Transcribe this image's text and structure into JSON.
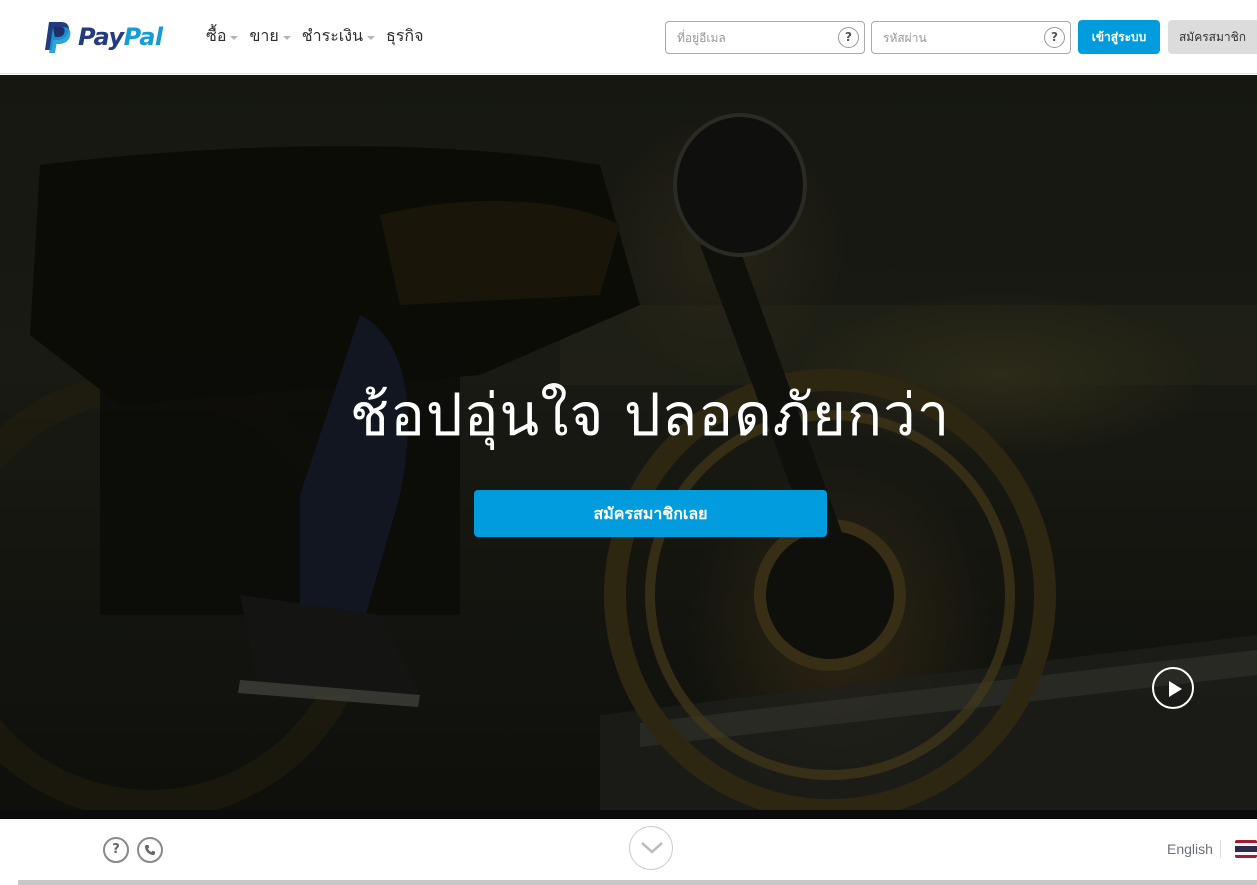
{
  "brand": {
    "pay": "Pay",
    "pal": "Pal",
    "colors": {
      "dark": "#253b80",
      "light": "#179bd7"
    }
  },
  "nav": {
    "items": [
      {
        "label": "ซื้อ",
        "has_dropdown": true
      },
      {
        "label": "ขาย",
        "has_dropdown": true
      },
      {
        "label": "ชำระเงิน",
        "has_dropdown": true
      },
      {
        "label": "ธุรกิจ",
        "has_dropdown": false
      }
    ]
  },
  "login": {
    "email_placeholder": "ที่อยู่อีเมล",
    "email_value": "",
    "password_placeholder": "รหัสผ่าน",
    "password_value": "",
    "help_symbol": "?",
    "login_button": "เข้าสู่ระบบ",
    "signup_button": "สมัครสมาชิก"
  },
  "hero": {
    "headline": "ช้อปอุ่นใจ ปลอดภัยกว่า",
    "cta": "สมัครสมาชิกเลย",
    "play_icon": "play-icon"
  },
  "footer": {
    "help_symbol": "?",
    "language_link": "English",
    "flag": "thailand-flag-icon"
  },
  "colors": {
    "accent": "#009cde",
    "text": "#2c2e2f",
    "muted": "#6c7378"
  }
}
